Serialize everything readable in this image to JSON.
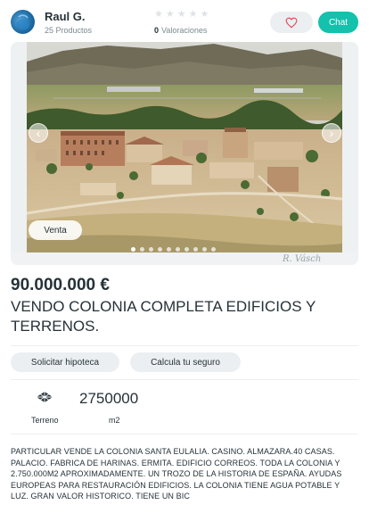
{
  "seller": {
    "name": "Raul G.",
    "products": "25 Productos",
    "rating_count": "0",
    "rating_label": "Valoraciones",
    "stars": 0,
    "stars_total": 5
  },
  "actions": {
    "chat_label": "Chat",
    "favorite_icon": "heart-icon"
  },
  "gallery": {
    "badge": "Venta",
    "prev_icon": "chevron-left-icon",
    "next_icon": "chevron-right-icon",
    "dot_count": 10,
    "active_dot": 1,
    "watermark": "R. Vásch"
  },
  "listing": {
    "price": "90.000.000 €",
    "title": "VENDO COLONIA COMPLETA EDIFICIOS Y TERRENOS.",
    "mortgage_label": "Solicitar hipoteca",
    "insurance_label": "Calcula tu seguro",
    "terrain_value": "2750000",
    "terrain_label": "Terreno",
    "terrain_unit": "m2",
    "terrain_icon": "land-plot-icon",
    "description": "PARTICULAR VENDE LA COLONIA SANTA EULALIA. CASINO. ALMAZARA.40 CASAS. PALACIO. FABRICA DE HARINAS. ERMITA. EDIFICIO CORREOS. TODA LA COLONIA Y 2.750.000M2 APROXIMADAMENTE. UN TROZO DE LA HISTORIA DE ESPAÑA. AYUDAS EUROPEAS PARA RESTAURACIÓN EDIFICIOS. LA COLONIA TIENE AGUA POTABLE Y LUZ. GRAN VALOR HISTORICO. TIENE UN BIC"
  },
  "colors": {
    "accent": "#13c1ac",
    "text": "#253238",
    "muted": "#7b8a90",
    "pill_bg": "#eceff1",
    "heart": "#e64c5c"
  }
}
